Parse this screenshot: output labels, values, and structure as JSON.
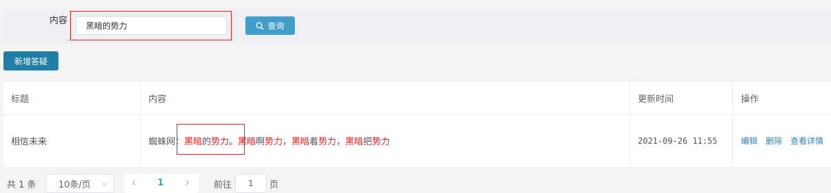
{
  "search": {
    "label": "内容",
    "value": "黑暗的势力",
    "query_button": "查询"
  },
  "toolbar": {
    "add_label": "新增答疑"
  },
  "table": {
    "headers": [
      "标题",
      "内容",
      "更新时间",
      "操作"
    ],
    "rows": [
      {
        "title": "相信未来",
        "content_segments": [
          {
            "text": "蜘蛛网：",
            "highlight": false
          },
          {
            "text": "黑暗",
            "highlight": true
          },
          {
            "text": "的",
            "highlight": false
          },
          {
            "text": "势力",
            "highlight": true
          },
          {
            "text": "。",
            "highlight": false
          },
          {
            "text": "黑暗",
            "highlight": true
          },
          {
            "text": "啊",
            "highlight": false
          },
          {
            "text": "势力",
            "highlight": true
          },
          {
            "text": "，",
            "highlight": false
          },
          {
            "text": "黑暗",
            "highlight": true
          },
          {
            "text": "着",
            "highlight": false
          },
          {
            "text": "势力",
            "highlight": true
          },
          {
            "text": "，",
            "highlight": false
          },
          {
            "text": "黑暗",
            "highlight": true
          },
          {
            "text": "把",
            "highlight": false
          },
          {
            "text": "势力",
            "highlight": true
          }
        ],
        "updated": "2021-09-26 11:55",
        "actions": [
          "编辑",
          "删除",
          "查看详情"
        ]
      }
    ]
  },
  "pagination": {
    "total": "共 1 条",
    "page_size": "10条/页",
    "current_page": "1",
    "goto_label": "前往",
    "goto_value": "1",
    "page_suffix": "页"
  },
  "colors": {
    "primary": "#409eca",
    "highlight": "#e8211e",
    "annotation_box": "#e02020"
  }
}
